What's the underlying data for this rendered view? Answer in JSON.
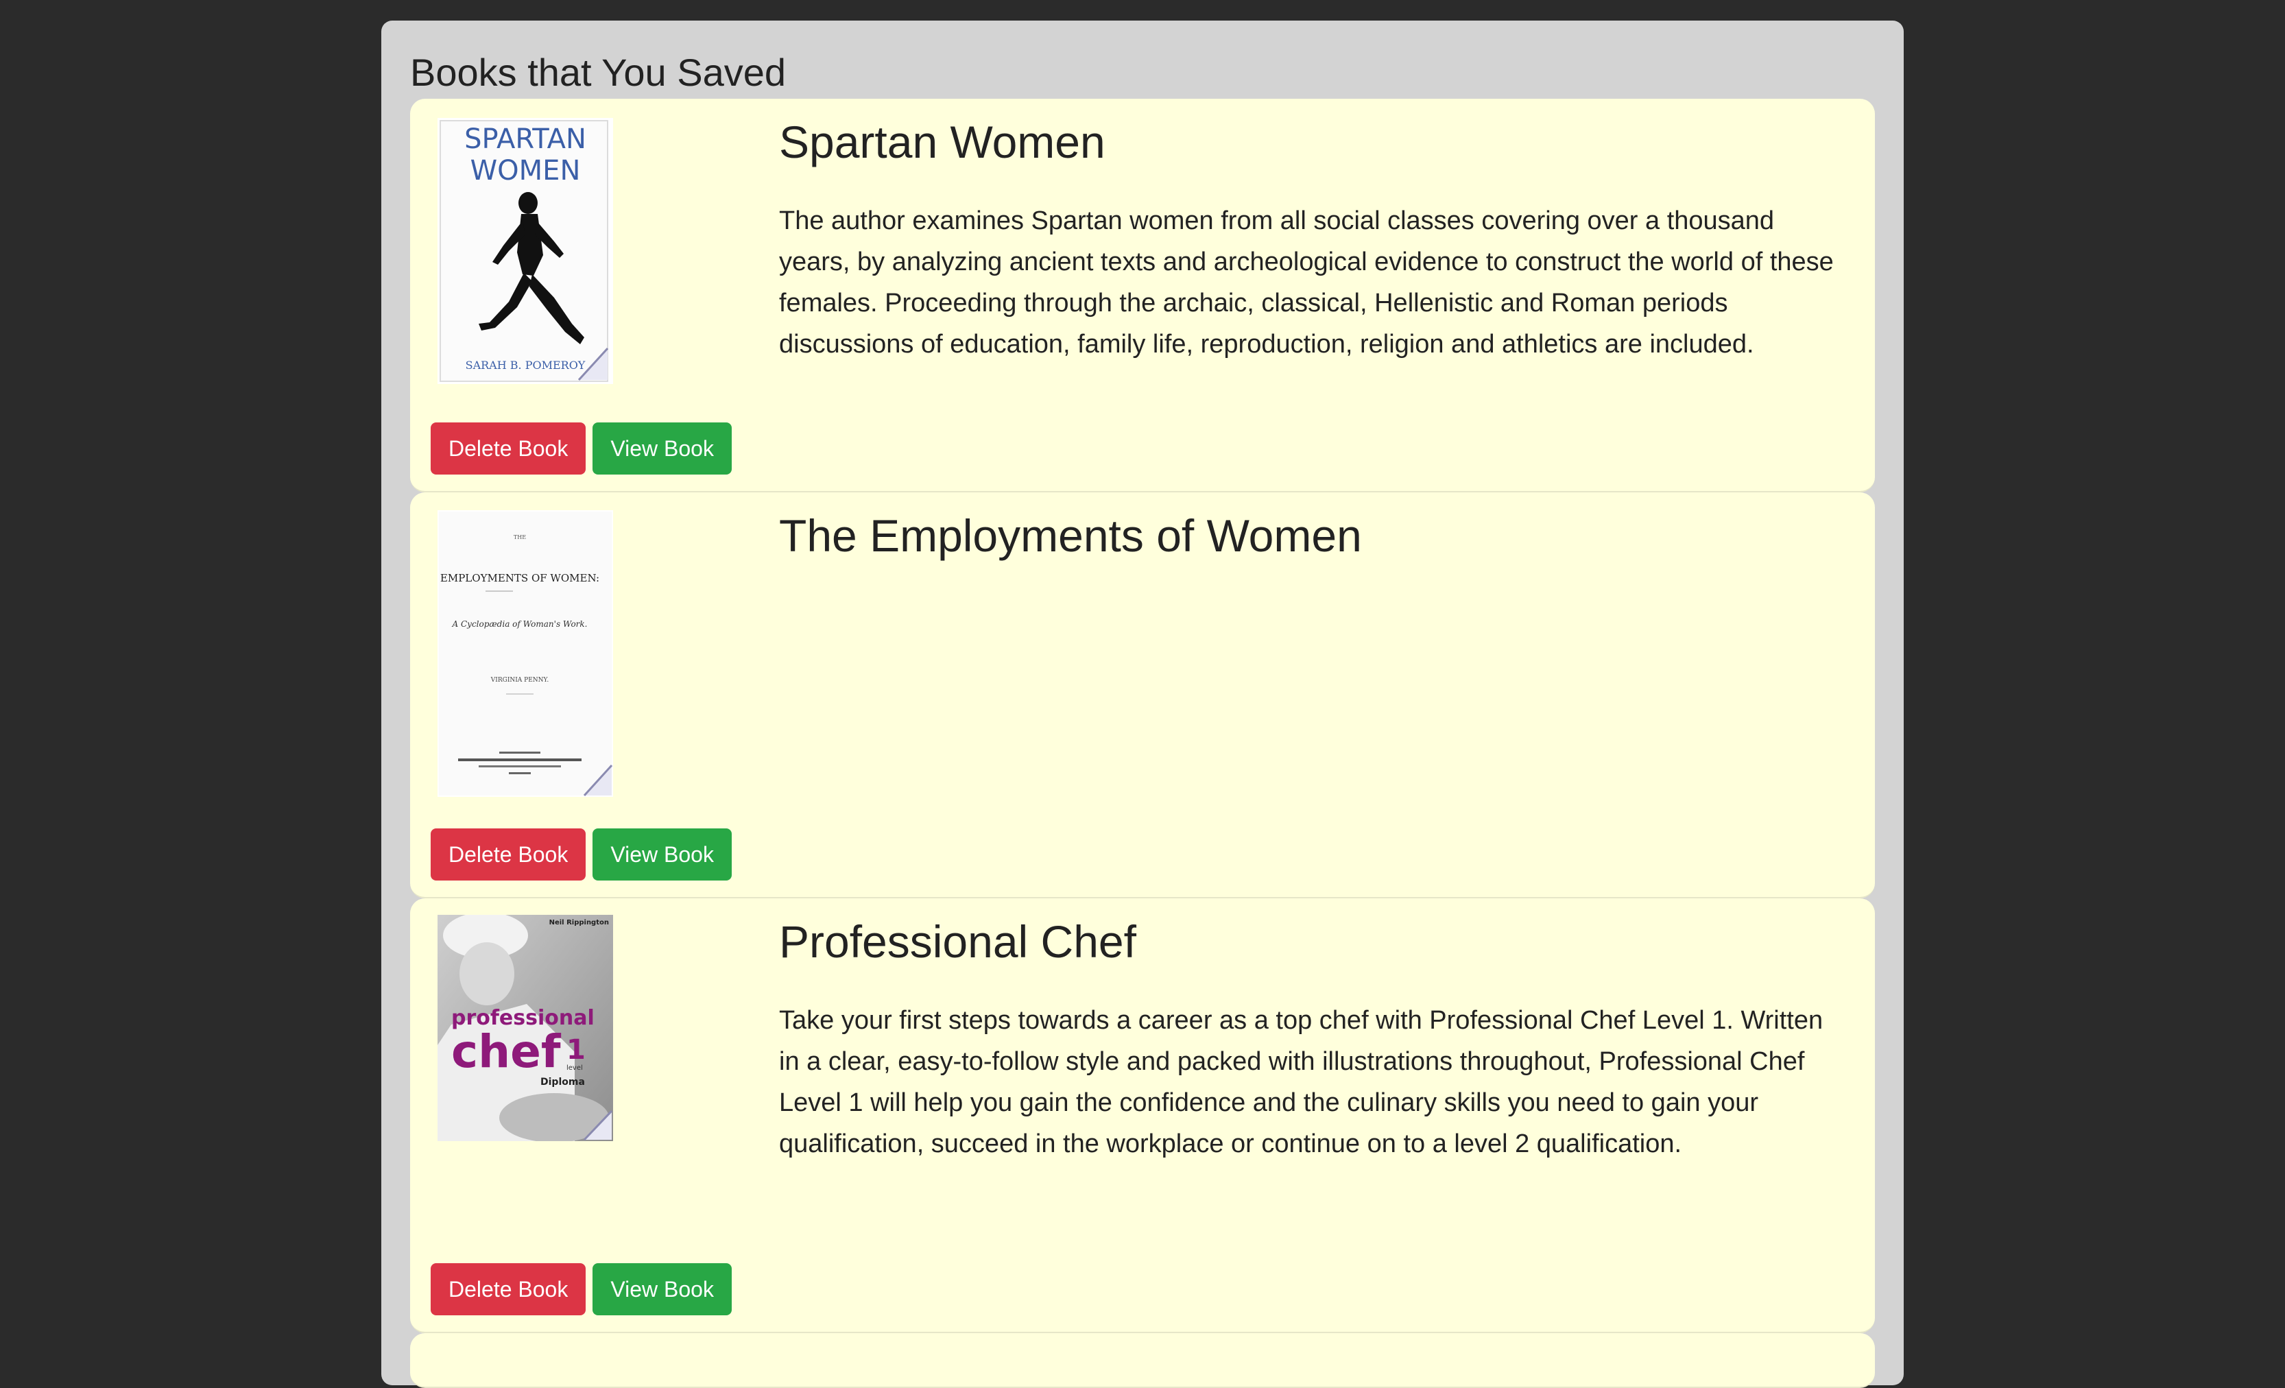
{
  "page": {
    "title": "Books that You Saved"
  },
  "colors": {
    "background": "#2b2b2b",
    "panel": "#d3d3d3",
    "card": "#ffffdc",
    "delete": "#dc3545",
    "view": "#28a745"
  },
  "books": [
    {
      "title": "Spartan Women",
      "description": "The author examines Spartan women from all social classes covering over a thousand years, by analyzing ancient texts and archeological evidence to construct the world of these females. Proceeding through the archaic, classical, Hellenistic and Roman periods discussions of education, family life, reproduction, religion and athletics are included.",
      "cover": {
        "line1": "SPARTAN",
        "line2": "WOMEN",
        "author": "SARAH B. POMEROY"
      },
      "delete_label": "Delete Book",
      "view_label": "View Book"
    },
    {
      "title": "The Employments of Women",
      "description": "",
      "cover": {
        "line1": "EMPLOYMENTS OF WOMEN:",
        "line2": "A Cyclopædia of Woman's Work.",
        "author": "VIRGINIA PENNY."
      },
      "delete_label": "Delete Book",
      "view_label": "View Book"
    },
    {
      "title": "Professional Chef",
      "description": "Take your first steps towards a career as a top chef with Professional Chef Level 1. Written in a clear, easy-to-follow style and packed with illustrations throughout, Professional Chef Level 1 will help you gain the confidence and the culinary skills you need to gain your qualification, succeed in the workplace or continue on to a level 2 qualification.",
      "cover": {
        "author": "Neil Rippington",
        "line1": "professional",
        "line2": "chef",
        "level": "1",
        "level_word": "level",
        "line3": "Diploma"
      },
      "delete_label": "Delete Book",
      "view_label": "View Book"
    }
  ]
}
